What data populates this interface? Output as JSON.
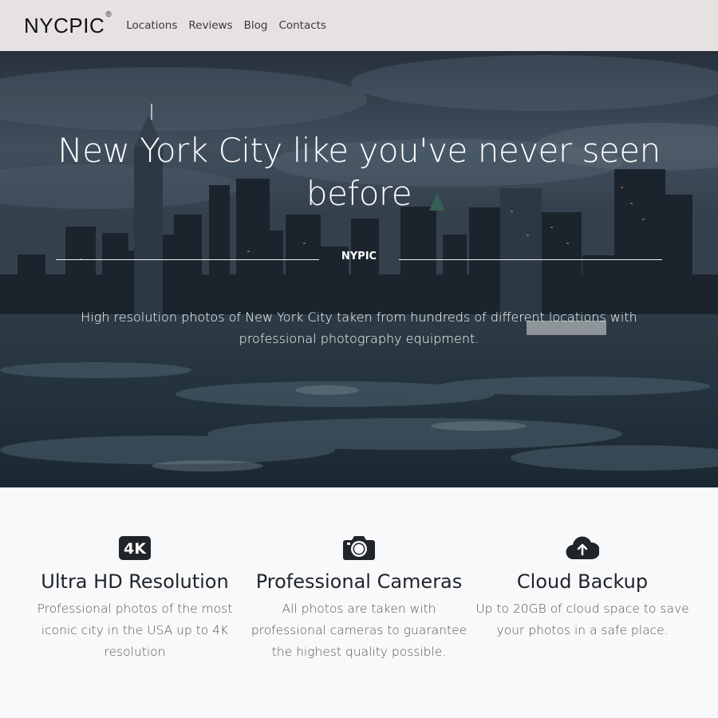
{
  "navbar": {
    "brand": "NYCPIC",
    "brand_mark": "®",
    "links": [
      "Locations",
      "Reviews",
      "Blog",
      "Contacts"
    ]
  },
  "hero": {
    "title": "New York City like you've never seen before",
    "divider_label": "NYPIC",
    "subtitle": "High resolution photos of New York City taken from hundreds of different locations with professional photography equipment."
  },
  "features": [
    {
      "icon": "4k-icon",
      "icon_text": "4K",
      "title": "Ultra HD Resolution",
      "text": "Professional photos of the most iconic city in the USA up to 4K resolution"
    },
    {
      "icon": "camera-icon",
      "title": "Professional Cameras",
      "text": "All photos are taken with professional cameras to guarantee the highest quality possible."
    },
    {
      "icon": "cloud-upload-icon",
      "title": "Cloud Backup",
      "text": "Up to 20GB of cloud space to save your photos in a safe place."
    }
  ],
  "colors": {
    "navbar_bg": "#e6e2e2",
    "features_bg": "#f8f9fa",
    "icon_dark": "#212529"
  }
}
